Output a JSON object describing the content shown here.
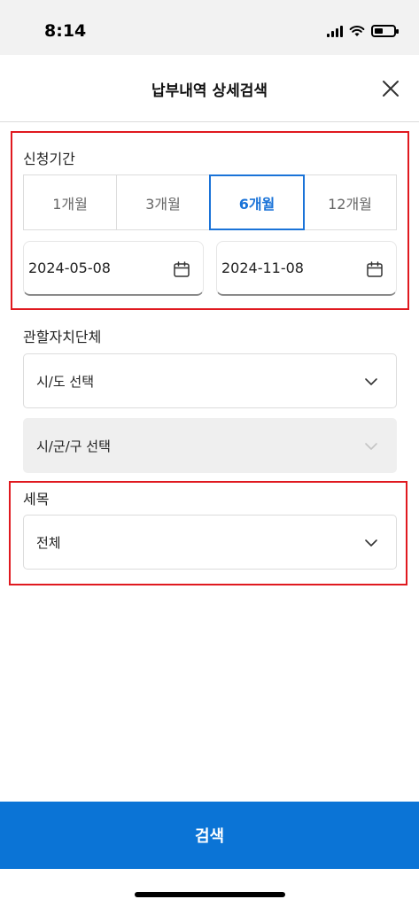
{
  "status_bar": {
    "time": "8:14"
  },
  "header": {
    "title": "납부내역 상세검색"
  },
  "application_period": {
    "label": "신청기간",
    "tabs": [
      "1개월",
      "3개월",
      "6개월",
      "12개월"
    ],
    "selected_tab": "6개월",
    "start_date": "2024-05-08",
    "end_date": "2024-11-08"
  },
  "region": {
    "label": "관할자치단체",
    "province_placeholder": "시/도 선택",
    "district_placeholder": "시/군/구 선택"
  },
  "tax_item": {
    "label": "세목",
    "selected": "전체"
  },
  "actions": {
    "search_label": "검색"
  },
  "colors": {
    "accent": "#0b74d6",
    "highlight": "#e0191f"
  }
}
